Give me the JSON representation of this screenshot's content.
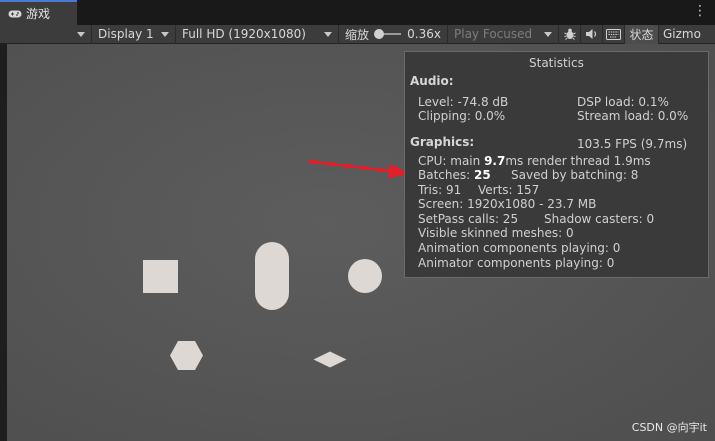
{
  "tab": {
    "label": "游戏",
    "icon": "gamepad-icon"
  },
  "toolbar": {
    "display": "Display 1",
    "resolution": "Full HD (1920x1080)",
    "scale_label": "缩放",
    "scale_value": "0.36x",
    "play_mode": "Play Focused",
    "bug_icon": "bug-icon",
    "audio_icon": "speaker-icon",
    "stats_icon": "keyboard-icon",
    "status_label": "状态",
    "gizmos_label": "Gizmo"
  },
  "stats": {
    "title": "Statistics",
    "audio_heading": "Audio:",
    "level": "Level: -74.8 dB",
    "clipping": "Clipping: 0.0%",
    "dsp_load": "DSP load: 0.1%",
    "stream_load": "Stream load: 0.0%",
    "graphics_heading": "Graphics:",
    "fps": "103.5 FPS (9.7ms)",
    "cpu_prefix": "CPU: main ",
    "cpu_main": "9.7",
    "cpu_suffix": "ms  render thread 1.9ms",
    "batches_prefix": "Batches: ",
    "batches_value": "25",
    "saved_by_batching": "Saved by batching: 8",
    "tris": "Tris: 91",
    "verts": "Verts: 157",
    "screen": "Screen: 1920x1080 - 23.7 MB",
    "setpass": "SetPass calls: 25",
    "shadow_casters": "Shadow casters: 0",
    "skinned_meshes": "Visible skinned meshes: 0",
    "animation_components": "Animation components playing: 0",
    "animator_components": "Animator components playing: 0"
  },
  "colors": {
    "arrow": "#e0202a",
    "shape": "#ded8d4",
    "tab_accent": "#4a7bd1"
  },
  "watermark": "CSDN @向宇it"
}
